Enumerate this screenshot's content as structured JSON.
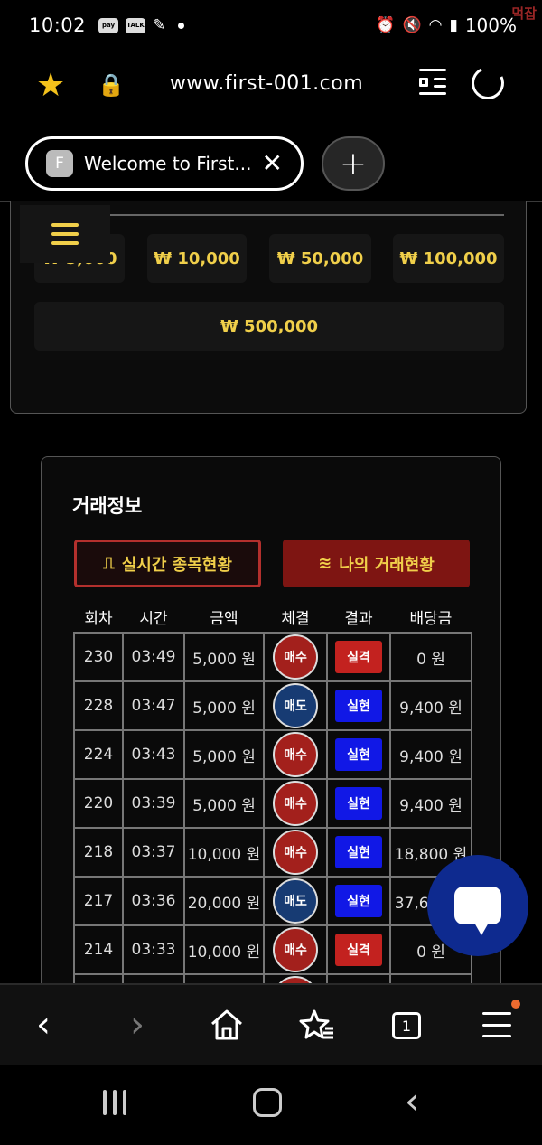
{
  "status_bar": {
    "time": "10:02",
    "apps": [
      "pay",
      "TALK"
    ],
    "battery": "100%",
    "watermark": "먹잡"
  },
  "browser": {
    "url": "www.first-001.com",
    "tab_title": "Welcome to First...",
    "favicon_letter": "F",
    "close_glyph": "✕",
    "new_tab_glyph": "+"
  },
  "amount_buttons": [
    {
      "label": "₩ 5,000"
    },
    {
      "label": "₩ 10,000"
    },
    {
      "label": "₩ 50,000"
    },
    {
      "label": "₩ 100,000"
    },
    {
      "label": "₩ 500,000"
    }
  ],
  "trade_panel": {
    "title": "거래정보",
    "tab_live": "실시간 종목현황",
    "tab_live_icon": "⎍",
    "tab_my": "나의 거래현황",
    "tab_my_icon": "≋",
    "headers": [
      "회차",
      "시간",
      "금액",
      "체결",
      "결과",
      "배당금"
    ],
    "rows": [
      {
        "round": "230",
        "time": "03:49",
        "amount": "5,000 원",
        "side": "매수",
        "result": "실격",
        "payout": "0 원"
      },
      {
        "round": "228",
        "time": "03:47",
        "amount": "5,000 원",
        "side": "매도",
        "result": "실현",
        "payout": "9,400 원"
      },
      {
        "round": "224",
        "time": "03:43",
        "amount": "5,000 원",
        "side": "매수",
        "result": "실현",
        "payout": "9,400 원"
      },
      {
        "round": "220",
        "time": "03:39",
        "amount": "5,000 원",
        "side": "매수",
        "result": "실현",
        "payout": "9,400 원"
      },
      {
        "round": "218",
        "time": "03:37",
        "amount": "10,000 원",
        "side": "매수",
        "result": "실현",
        "payout": "18,800 원"
      },
      {
        "round": "217",
        "time": "03:36",
        "amount": "20,000 원",
        "side": "매도",
        "result": "실현",
        "payout": "37,600 원"
      },
      {
        "round": "214",
        "time": "03:33",
        "amount": "10,000 원",
        "side": "매수",
        "result": "실격",
        "payout": "0 원"
      },
      {
        "round": "",
        "time": "",
        "amount": "",
        "side": "매수",
        "result": "",
        "payout": ""
      }
    ]
  },
  "bottom_bar": {
    "back": "‹",
    "forward": "›",
    "tab_count": "1"
  },
  "colors": {
    "accent_gold": "#f0cf4a",
    "buy_red": "#a3201c",
    "sell_blue": "#173b73",
    "win_blue": "#1118e6",
    "loss_red": "#c3221f"
  }
}
